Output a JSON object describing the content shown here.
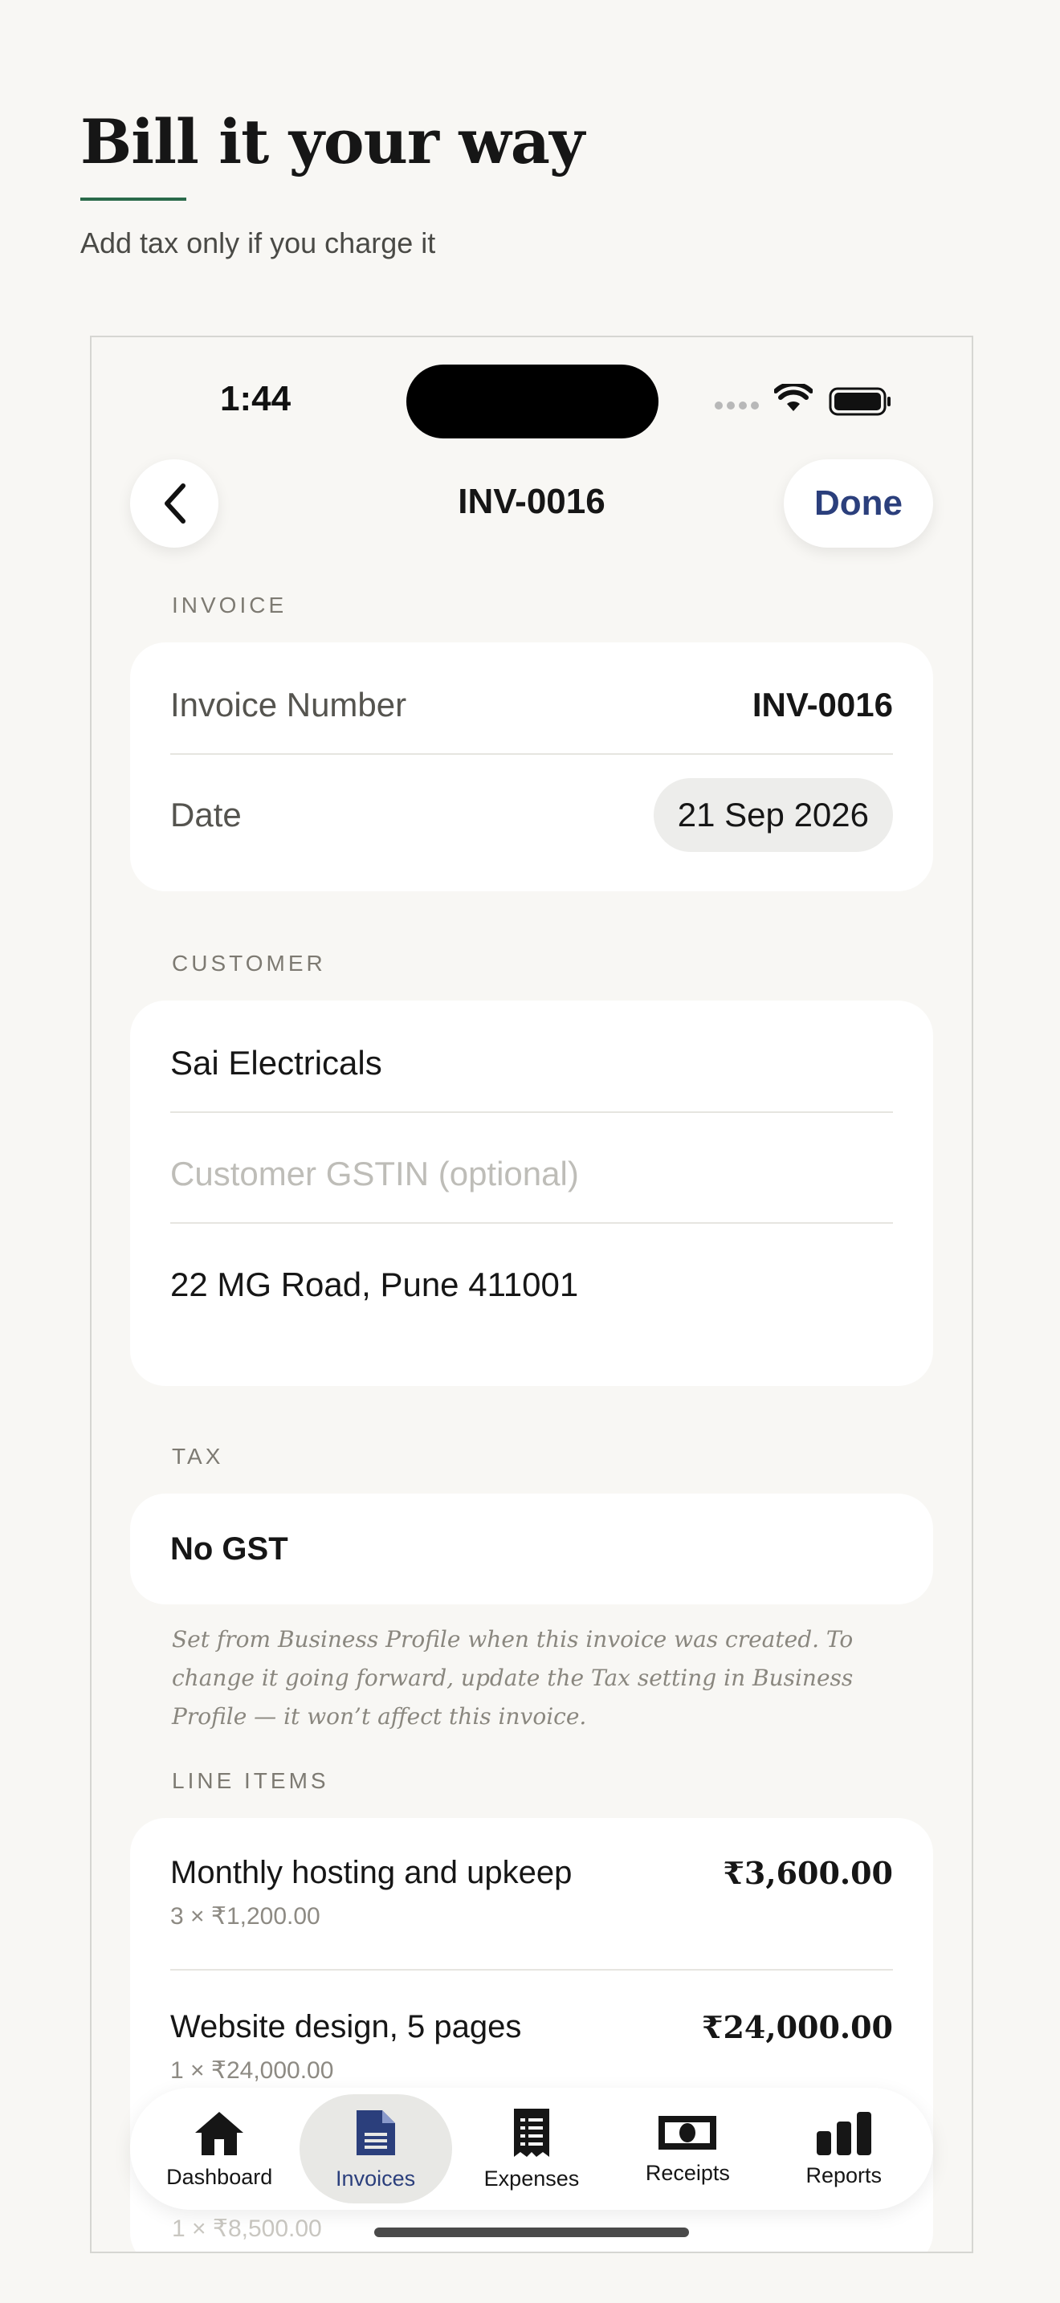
{
  "marketing": {
    "headline": "Bill it your way",
    "subhead": "Add tax only if you charge it"
  },
  "status_bar": {
    "time": "1:44"
  },
  "nav": {
    "title": "INV-0016",
    "done_label": "Done"
  },
  "invoice_section": {
    "label": "INVOICE",
    "number_label": "Invoice Number",
    "number_value": "INV-0016",
    "date_label": "Date",
    "date_value": "21 Sep 2026"
  },
  "customer_section": {
    "label": "CUSTOMER",
    "name": "Sai Electricals",
    "gstin_placeholder": "Customer GSTIN (optional)",
    "address": "22 MG Road, Pune 411001"
  },
  "tax_section": {
    "label": "TAX",
    "value": "No GST",
    "note": "Set from Business Profile when this invoice was created. To change it going forward, update the Tax setting in Business Profile — it won’t affect this invoice."
  },
  "line_items_section": {
    "label": "LINE ITEMS",
    "items": [
      {
        "name": "Monthly hosting and upkeep",
        "qty": "3 × ₹1,200.00",
        "amount": "₹3,600.00"
      },
      {
        "name": "Website design, 5 pages",
        "qty": "1 × ₹24,000.00",
        "amount": "₹24,000.00"
      }
    ],
    "partial_qty": "1 × ₹8,500.00"
  },
  "tabbar": {
    "tabs": [
      {
        "label": "Dashboard",
        "icon": "home-icon",
        "active": false
      },
      {
        "label": "Invoices",
        "icon": "document-icon",
        "active": true
      },
      {
        "label": "Expenses",
        "icon": "receipt-list-icon",
        "active": false
      },
      {
        "label": "Receipts",
        "icon": "banknote-icon",
        "active": false
      },
      {
        "label": "Reports",
        "icon": "bar-chart-icon",
        "active": false
      }
    ],
    "active_color": "#2b3f7c"
  },
  "colors": {
    "accent_rule": "#2a6a4a",
    "done_text": "#2b3f7c",
    "background": "#f8f7f4"
  }
}
